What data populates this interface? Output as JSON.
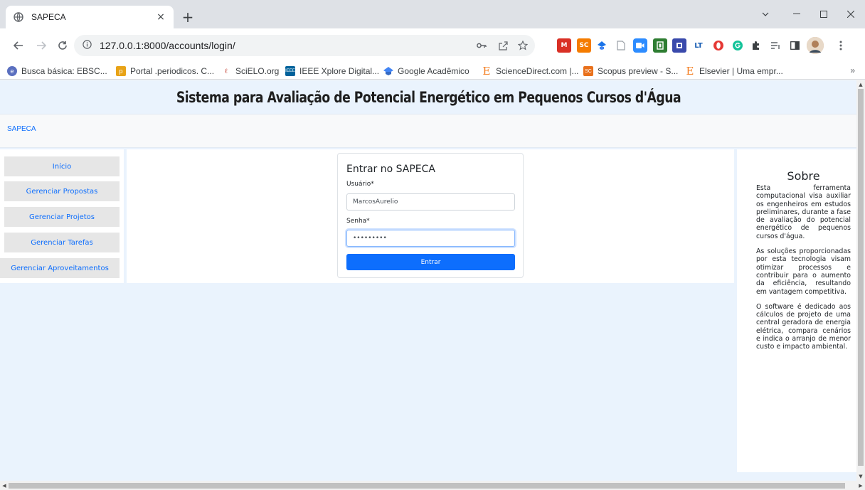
{
  "browser": {
    "tab_title": "SAPECA",
    "tab_close": "×",
    "new_tab": "+",
    "url": "127.0.0.1:8000/accounts/login/",
    "bookmarks": [
      {
        "label": "Busca básica: EBSC...",
        "color": "#5a6fbf"
      },
      {
        "label": "Portal .periodicos. C...",
        "color": "#e8a317"
      },
      {
        "label": "SciELO.org",
        "color": "#c0392b"
      },
      {
        "label": "IEEE Xplore Digital...",
        "color": "#00629b"
      },
      {
        "label": "Google Acadêmico",
        "color": "#4285f4"
      },
      {
        "label": "ScienceDirect.com |...",
        "color": "#f47d20"
      },
      {
        "label": "Scopus preview - S...",
        "color": "#e9711c"
      },
      {
        "label": "Elsevier | Uma empr...",
        "color": "#f47d20"
      }
    ],
    "bookmarks_more": "»"
  },
  "header": {
    "title": "Sistema para Avaliação de Potencial Energético em Pequenos Cursos d'Água"
  },
  "navbar": {
    "brand": "SAPECA"
  },
  "sidemenu": {
    "items": [
      {
        "label": "Início"
      },
      {
        "label": "Gerenciar Propostas"
      },
      {
        "label": "Gerenciar Projetos"
      },
      {
        "label": "Gerenciar Tarefas"
      },
      {
        "label": "Gerenciar Aproveitamentos"
      }
    ]
  },
  "login": {
    "title": "Entrar no SAPECA",
    "username_label": "Usuário*",
    "username_value": "MarcosAurelio",
    "password_label": "Senha*",
    "password_value": "•••••••••",
    "submit_label": "Entrar"
  },
  "sidebar": {
    "title": "Sobre",
    "paragraphs": [
      "Esta ferramenta computacional visa auxiliar os engenheiros em estudos preliminares, durante a fase de avaliação do potencial energético de pequenos cursos d'água.",
      "As soluções proporcionadas por esta tecnologia visam otimizar processos e contribuir para o aumento da eficiência, resultando em vantagem competitiva.",
      "O software é dedicado aos cálculos de projeto de uma central geradora de energia elétrica, compara cenários e indica o arranjo de menor custo e impacto ambiental."
    ]
  }
}
